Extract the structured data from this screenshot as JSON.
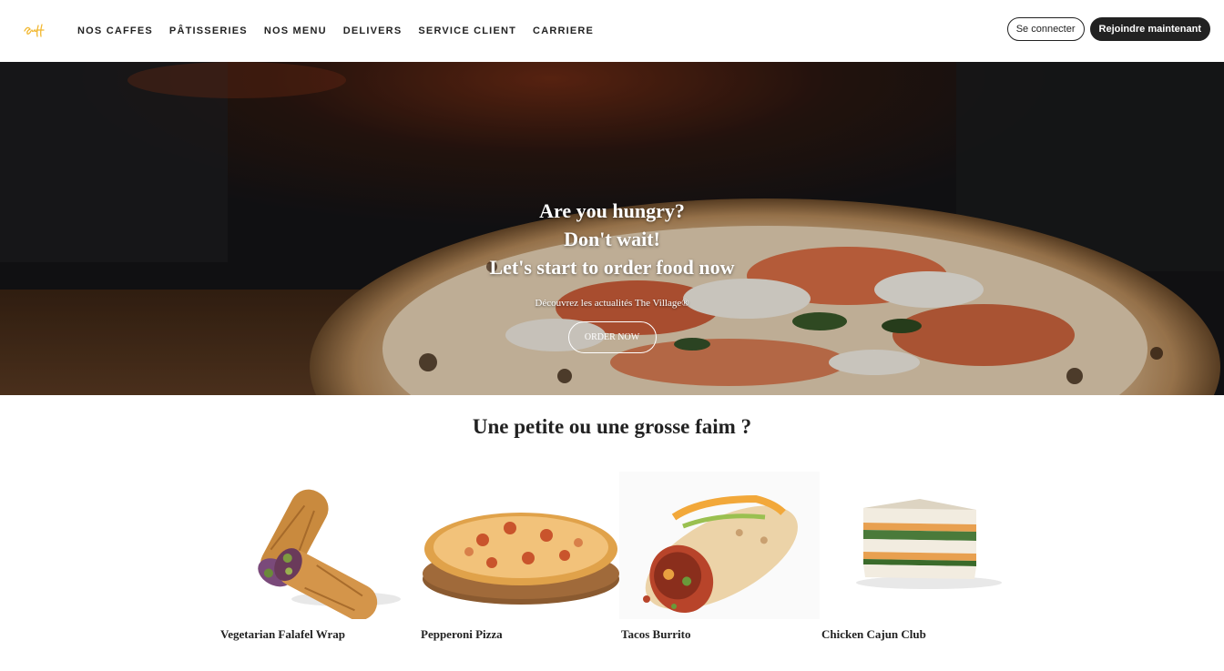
{
  "header": {
    "nav": [
      {
        "label": "NOS CAFFES"
      },
      {
        "label": "PÂTISSERIES"
      },
      {
        "label": "NOS MENU"
      },
      {
        "label": "DELIVERS"
      },
      {
        "label": "SERVICE CLIENT"
      },
      {
        "label": "CARRIERE"
      }
    ],
    "login_label": "Se connecter",
    "join_label": "Rejoindre maintenant"
  },
  "hero": {
    "line1": "Are you hungry?",
    "line2": "Don't wait!",
    "line3": "Let's start to order food now",
    "subtitle": "Découvrez les actualités The Village®",
    "button_label": "ORDER NOW"
  },
  "section": {
    "title": "Une petite ou une grosse faim ?"
  },
  "products": [
    {
      "name": "Vegetarian Falafel Wrap",
      "image": "falafel-wrap-image"
    },
    {
      "name": "Pepperoni Pizza",
      "image": "pepperoni-pizza-image"
    },
    {
      "name": "Tacos Burrito",
      "image": "tacos-burrito-image"
    },
    {
      "name": "Chicken Cajun Club",
      "image": "chicken-cajun-club-image"
    }
  ],
  "colors": {
    "primary": "#222222",
    "logo": "#f2b832",
    "background": "#ffffff"
  }
}
